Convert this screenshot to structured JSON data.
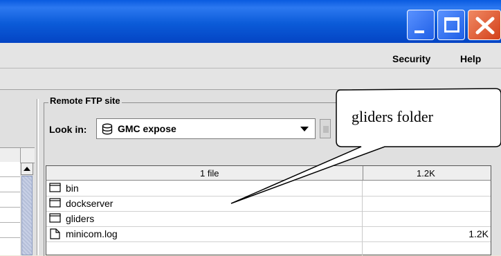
{
  "menubar": {
    "items": [
      "Security",
      "Help"
    ]
  },
  "remote_site": {
    "group_title": "Remote FTP site",
    "look_in_label": "Look in:",
    "look_in_value": "GMC expose"
  },
  "table": {
    "header_count": "1 file",
    "header_size": "1.2K",
    "rows": [
      {
        "name": "bin",
        "type": "folder",
        "size": ""
      },
      {
        "name": "dockserver",
        "type": "folder",
        "size": ""
      },
      {
        "name": "gliders",
        "type": "folder",
        "size": ""
      },
      {
        "name": "minicom.log",
        "type": "file",
        "size": "1.2K"
      }
    ]
  },
  "callout": {
    "text": "gliders folder"
  },
  "colors": {
    "titlebar": "#0b5bd8",
    "close_button": "#d3401a",
    "background": "#e0e0e0"
  },
  "icons": [
    "minimize-icon",
    "maximize-icon",
    "close-icon",
    "database-icon",
    "dropdown-arrow-icon",
    "folder-icon",
    "file-icon"
  ]
}
